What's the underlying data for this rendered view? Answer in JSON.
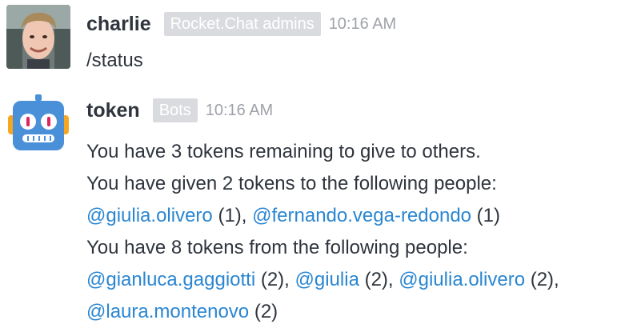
{
  "messages": [
    {
      "username": "charlie",
      "role": "Rocket.Chat admins",
      "time": "10:16 AM",
      "text": "/status"
    },
    {
      "username": "token",
      "role": "Bots",
      "time": "10:16 AM",
      "line1": "You have 3 tokens remaining to give to others.",
      "line2": "You have given 2 tokens to the following people:",
      "line3": {
        "m1": "@giulia.olivero",
        "c1": " (1), ",
        "m2": "@fernando.vega-redondo",
        "c2": " (1)"
      },
      "line4": "You have 8 tokens from the following people:",
      "line5": {
        "m1": "@gianluca.gaggiotti",
        "c1": " (2), ",
        "m2": "@giulia",
        "c2": " (2), ",
        "m3": "@giulia.olivero",
        "c3": " (2),"
      },
      "line6": {
        "m1": "@laura.montenovo",
        "c1": " (2)"
      }
    }
  ],
  "colors": {
    "mention": "#2a86d1",
    "role_badge_bg": "#d9dbde",
    "time": "#9ea2a8",
    "robot_body": "#4a90d9",
    "robot_ear": "#f5a623"
  }
}
